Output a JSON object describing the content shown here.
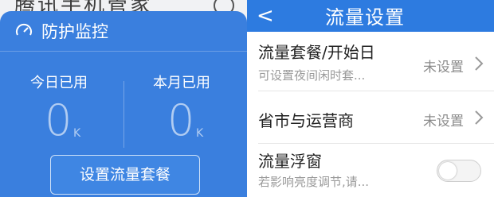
{
  "left": {
    "background_title": "腾讯手机管家",
    "card": {
      "title": "防护监控",
      "icon": "gauge-icon",
      "today_label": "今日已用",
      "today_value": "0",
      "today_unit": "K",
      "month_label": "本月已用",
      "month_value": "0",
      "month_unit": "K",
      "button_label": "设置流量套餐",
      "accent": "#3a7fde"
    }
  },
  "right": {
    "back_symbol": "<",
    "title": "流量设置",
    "rows": [
      {
        "title": "流量套餐/开始日",
        "subtitle": "可设置夜间闲时套...",
        "value": "未设置"
      },
      {
        "title": "省市与运营商",
        "value": "未设置"
      },
      {
        "title": "流量浮窗",
        "subtitle": "若影响亮度调节,请..."
      }
    ],
    "toggle_on": false,
    "bar_color": "#2d7be0"
  }
}
